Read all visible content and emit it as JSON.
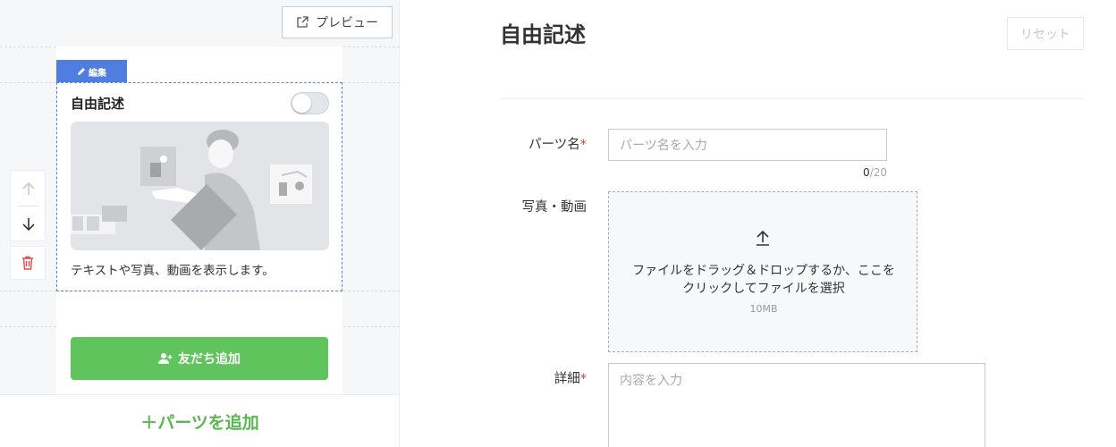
{
  "preview": {
    "preview_button_label": "プレビュー",
    "edit_tag_label": "編集",
    "block_title": "自由記述",
    "toggle_on": false,
    "block_description": "テキストや写真、動画を表示します。",
    "add_friend_label": "友だち追加",
    "add_parts_label": "＋パーツを追加"
  },
  "form": {
    "title": "自由記述",
    "reset_label": "リセット",
    "parts_name_label": "パーツ名",
    "parts_name_placeholder": "パーツ名を入力",
    "parts_name_count": "0",
    "parts_name_max": "/20",
    "media_label": "写真・動画",
    "upload_text": "ファイルをドラッグ＆ドロップするか、ここをクリックしてファイルを選択",
    "upload_size": "10MB",
    "details_label": "詳細",
    "details_placeholder": "内容を入力",
    "required_mark": "*"
  },
  "colors": {
    "accent_blue": "#4f7de0",
    "green": "#5ec45b",
    "required_red": "#e23c3c"
  }
}
